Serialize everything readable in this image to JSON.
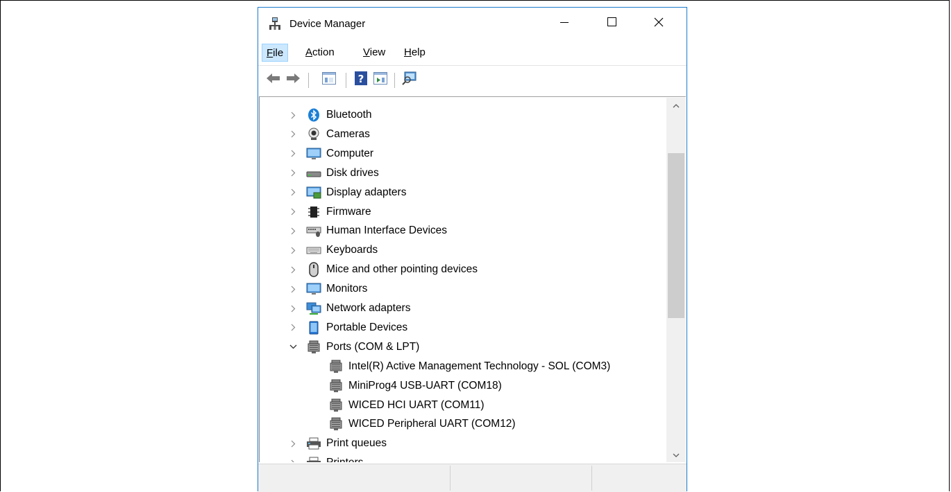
{
  "window": {
    "title": "Device Manager"
  },
  "menu": [
    {
      "pre": "",
      "key": "F",
      "post": "ile",
      "selected": true
    },
    {
      "pre": "",
      "key": "A",
      "post": "ction",
      "selected": false
    },
    {
      "pre": "",
      "key": "V",
      "post": "iew",
      "selected": false
    },
    {
      "pre": "",
      "key": "H",
      "post": "elp",
      "selected": false
    }
  ],
  "toolbar": [
    "back-icon",
    "forward-icon",
    "properties-icon",
    "help-icon",
    "update-driver-icon",
    "scan-hardware-icon"
  ],
  "tree": {
    "items": [
      {
        "label": "Bluetooth",
        "icon": "bluetooth-icon",
        "state": "collapsed"
      },
      {
        "label": "Cameras",
        "icon": "camera-icon",
        "state": "collapsed"
      },
      {
        "label": "Computer",
        "icon": "computer-icon",
        "state": "collapsed"
      },
      {
        "label": "Disk drives",
        "icon": "disk-drive-icon",
        "state": "collapsed"
      },
      {
        "label": "Display adapters",
        "icon": "display-adapter-icon",
        "state": "collapsed"
      },
      {
        "label": "Firmware",
        "icon": "firmware-icon",
        "state": "collapsed"
      },
      {
        "label": "Human Interface Devices",
        "icon": "hid-icon",
        "state": "collapsed"
      },
      {
        "label": "Keyboards",
        "icon": "keyboard-icon",
        "state": "collapsed"
      },
      {
        "label": "Mice and other pointing devices",
        "icon": "mouse-icon",
        "state": "collapsed"
      },
      {
        "label": "Monitors",
        "icon": "monitor-icon",
        "state": "collapsed"
      },
      {
        "label": "Network adapters",
        "icon": "network-adapter-icon",
        "state": "collapsed"
      },
      {
        "label": "Portable Devices",
        "icon": "portable-device-icon",
        "state": "collapsed"
      },
      {
        "label": "Ports (COM & LPT)",
        "icon": "port-icon",
        "state": "expanded"
      },
      {
        "label": "Intel(R) Active Management Technology - SOL (COM3)",
        "icon": "port-icon",
        "state": "child"
      },
      {
        "label": "MiniProg4 USB-UART (COM18)",
        "icon": "port-icon",
        "state": "child"
      },
      {
        "label": "WICED HCI UART (COM11)",
        "icon": "port-icon",
        "state": "child"
      },
      {
        "label": "WICED Peripheral UART (COM12)",
        "icon": "port-icon",
        "state": "child"
      },
      {
        "label": "Print queues",
        "icon": "printer-icon",
        "state": "collapsed"
      },
      {
        "label": "Printers",
        "icon": "printer-icon",
        "state": "collapsed"
      }
    ]
  },
  "colors": {
    "accent": "#1a7acb",
    "selection": "#cce8ff"
  }
}
